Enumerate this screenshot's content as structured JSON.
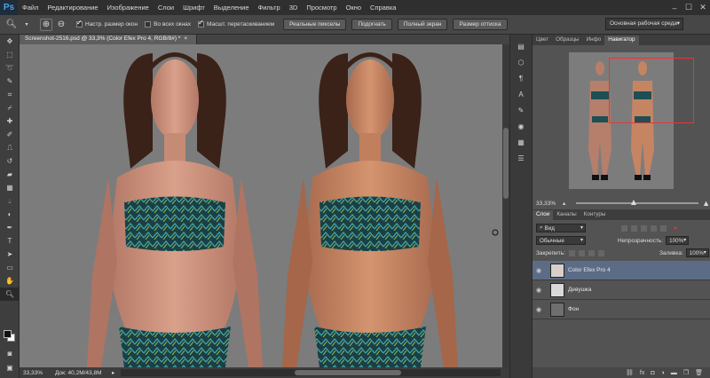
{
  "app": {
    "logo": "Ps"
  },
  "menu": [
    "Файл",
    "Редактирование",
    "Изображение",
    "Слои",
    "Шрифт",
    "Выделение",
    "Фильтр",
    "3D",
    "Просмотр",
    "Окно",
    "Справка"
  ],
  "window_controls": {
    "minimize": "–",
    "maximize": "☐",
    "close": "✕"
  },
  "options": {
    "fit_windows": "Настр. размер окон",
    "all_windows": "Во всех окнах",
    "scrubby_zoom": "Масшт. перетаскиванием",
    "actual_pixels": "Реальные пикселы",
    "fit_screen": "Подогнать",
    "fill_screen": "Полный экран",
    "print_size": "Размер оттиска",
    "workspace": "Основная рабочая среда"
  },
  "document": {
    "tab_title": "Screenshot-2516.psd @ 33,3% (Color Efex Pro 4, RGB/8#) *",
    "close_glyph": "×",
    "zoom": "33,33%",
    "doc_info": "Док: 40,2М/43,8М"
  },
  "navigator": {
    "tabs": [
      "Цвет",
      "Образцы",
      "Инфо",
      "Навигатор"
    ],
    "active_tab": 3,
    "zoom": "33,33%"
  },
  "layers_panel": {
    "tabs": [
      "Слои",
      "Каналы",
      "Контуры"
    ],
    "active_tab": 0,
    "filter_kind": "Вид",
    "blend_mode": "Обычные",
    "opacity_label": "Непрозрачность:",
    "opacity_value": "100%",
    "lock_label": "Закрепить:",
    "fill_label": "Заливка:",
    "fill_value": "100%",
    "layers": [
      {
        "name": "Color Efex Pro 4",
        "selected": true
      },
      {
        "name": "Девушка",
        "selected": false
      },
      {
        "name": "Фон",
        "selected": false
      }
    ],
    "footer_icons": [
      "link-icon",
      "fx-icon",
      "mask-icon",
      "adjustment-icon",
      "folder-icon",
      "new-layer-icon",
      "trash-icon"
    ]
  }
}
